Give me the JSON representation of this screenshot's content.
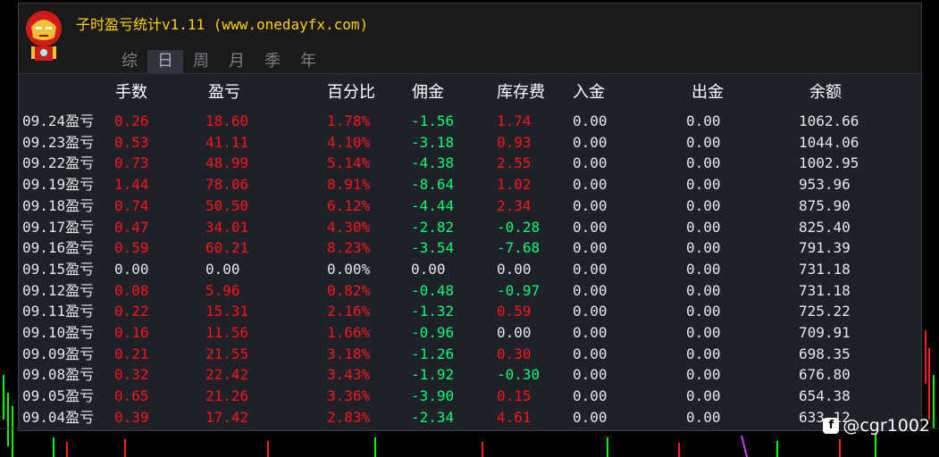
{
  "app": {
    "title": "子时盈亏统计v1.11 (www.onedayfx.com)"
  },
  "tabs": [
    {
      "label": "综",
      "active": false
    },
    {
      "label": "日",
      "active": true
    },
    {
      "label": "周",
      "active": false
    },
    {
      "label": "月",
      "active": false
    },
    {
      "label": "季",
      "active": false
    },
    {
      "label": "年",
      "active": false
    }
  ],
  "columns": {
    "lots": "手数",
    "pl": "盈亏",
    "pct": "百分比",
    "commission": "佣金",
    "swap": "库存费",
    "deposit": "入金",
    "withdraw": "出金",
    "balance": "余额"
  },
  "colors": {
    "positive": "#ff1414",
    "negative": "#00ff70",
    "neutral": "#e8e8e8",
    "title": "#ffd200"
  },
  "rows": [
    {
      "label": "09.24盈亏",
      "lots": "0.26",
      "pl": "18.60",
      "pct": "1.78%",
      "commission": "-1.56",
      "swap": "1.74",
      "deposit": "0.00",
      "withdraw": "0.00",
      "balance": "1062.66"
    },
    {
      "label": "09.23盈亏",
      "lots": "0.53",
      "pl": "41.11",
      "pct": "4.10%",
      "commission": "-3.18",
      "swap": "0.93",
      "deposit": "0.00",
      "withdraw": "0.00",
      "balance": "1044.06"
    },
    {
      "label": "09.22盈亏",
      "lots": "0.73",
      "pl": "48.99",
      "pct": "5.14%",
      "commission": "-4.38",
      "swap": "2.55",
      "deposit": "0.00",
      "withdraw": "0.00",
      "balance": "1002.95"
    },
    {
      "label": "09.19盈亏",
      "lots": "1.44",
      "pl": "78.06",
      "pct": "8.91%",
      "commission": "-8.64",
      "swap": "1.02",
      "deposit": "0.00",
      "withdraw": "0.00",
      "balance": "953.96"
    },
    {
      "label": "09.18盈亏",
      "lots": "0.74",
      "pl": "50.50",
      "pct": "6.12%",
      "commission": "-4.44",
      "swap": "2.34",
      "deposit": "0.00",
      "withdraw": "0.00",
      "balance": "875.90"
    },
    {
      "label": "09.17盈亏",
      "lots": "0.47",
      "pl": "34.01",
      "pct": "4.30%",
      "commission": "-2.82",
      "swap": "-0.28",
      "deposit": "0.00",
      "withdraw": "0.00",
      "balance": "825.40"
    },
    {
      "label": "09.16盈亏",
      "lots": "0.59",
      "pl": "60.21",
      "pct": "8.23%",
      "commission": "-3.54",
      "swap": "-7.68",
      "deposit": "0.00",
      "withdraw": "0.00",
      "balance": "791.39"
    },
    {
      "label": "09.15盈亏",
      "lots": "0.00",
      "pl": "0.00",
      "pct": "0.00%",
      "commission": "0.00",
      "swap": "0.00",
      "deposit": "0.00",
      "withdraw": "0.00",
      "balance": "731.18"
    },
    {
      "label": "09.12盈亏",
      "lots": "0.08",
      "pl": "5.96",
      "pct": "0.82%",
      "commission": "-0.48",
      "swap": "-0.97",
      "deposit": "0.00",
      "withdraw": "0.00",
      "balance": "731.18"
    },
    {
      "label": "09.11盈亏",
      "lots": "0.22",
      "pl": "15.31",
      "pct": "2.16%",
      "commission": "-1.32",
      "swap": "0.59",
      "deposit": "0.00",
      "withdraw": "0.00",
      "balance": "725.22"
    },
    {
      "label": "09.10盈亏",
      "lots": "0.16",
      "pl": "11.56",
      "pct": "1.66%",
      "commission": "-0.96",
      "swap": "0.00",
      "deposit": "0.00",
      "withdraw": "0.00",
      "balance": "709.91"
    },
    {
      "label": "09.09盈亏",
      "lots": "0.21",
      "pl": "21.55",
      "pct": "3.18%",
      "commission": "-1.26",
      "swap": "0.30",
      "deposit": "0.00",
      "withdraw": "0.00",
      "balance": "698.35"
    },
    {
      "label": "09.08盈亏",
      "lots": "0.32",
      "pl": "22.42",
      "pct": "3.43%",
      "commission": "-1.92",
      "swap": "-0.30",
      "deposit": "0.00",
      "withdraw": "0.00",
      "balance": "676.80"
    },
    {
      "label": "09.05盈亏",
      "lots": "0.65",
      "pl": "21.26",
      "pct": "3.36%",
      "commission": "-3.90",
      "swap": "0.15",
      "deposit": "0.00",
      "withdraw": "0.00",
      "balance": "654.38"
    },
    {
      "label": "09.04盈亏",
      "lots": "0.39",
      "pl": "17.42",
      "pct": "2.83%",
      "commission": "-2.34",
      "swap": "4.61",
      "deposit": "0.00",
      "withdraw": "0.00",
      "balance": "633.12"
    }
  ],
  "watermark": {
    "icon": "platform-logo-icon",
    "text": "@cgr1002"
  }
}
